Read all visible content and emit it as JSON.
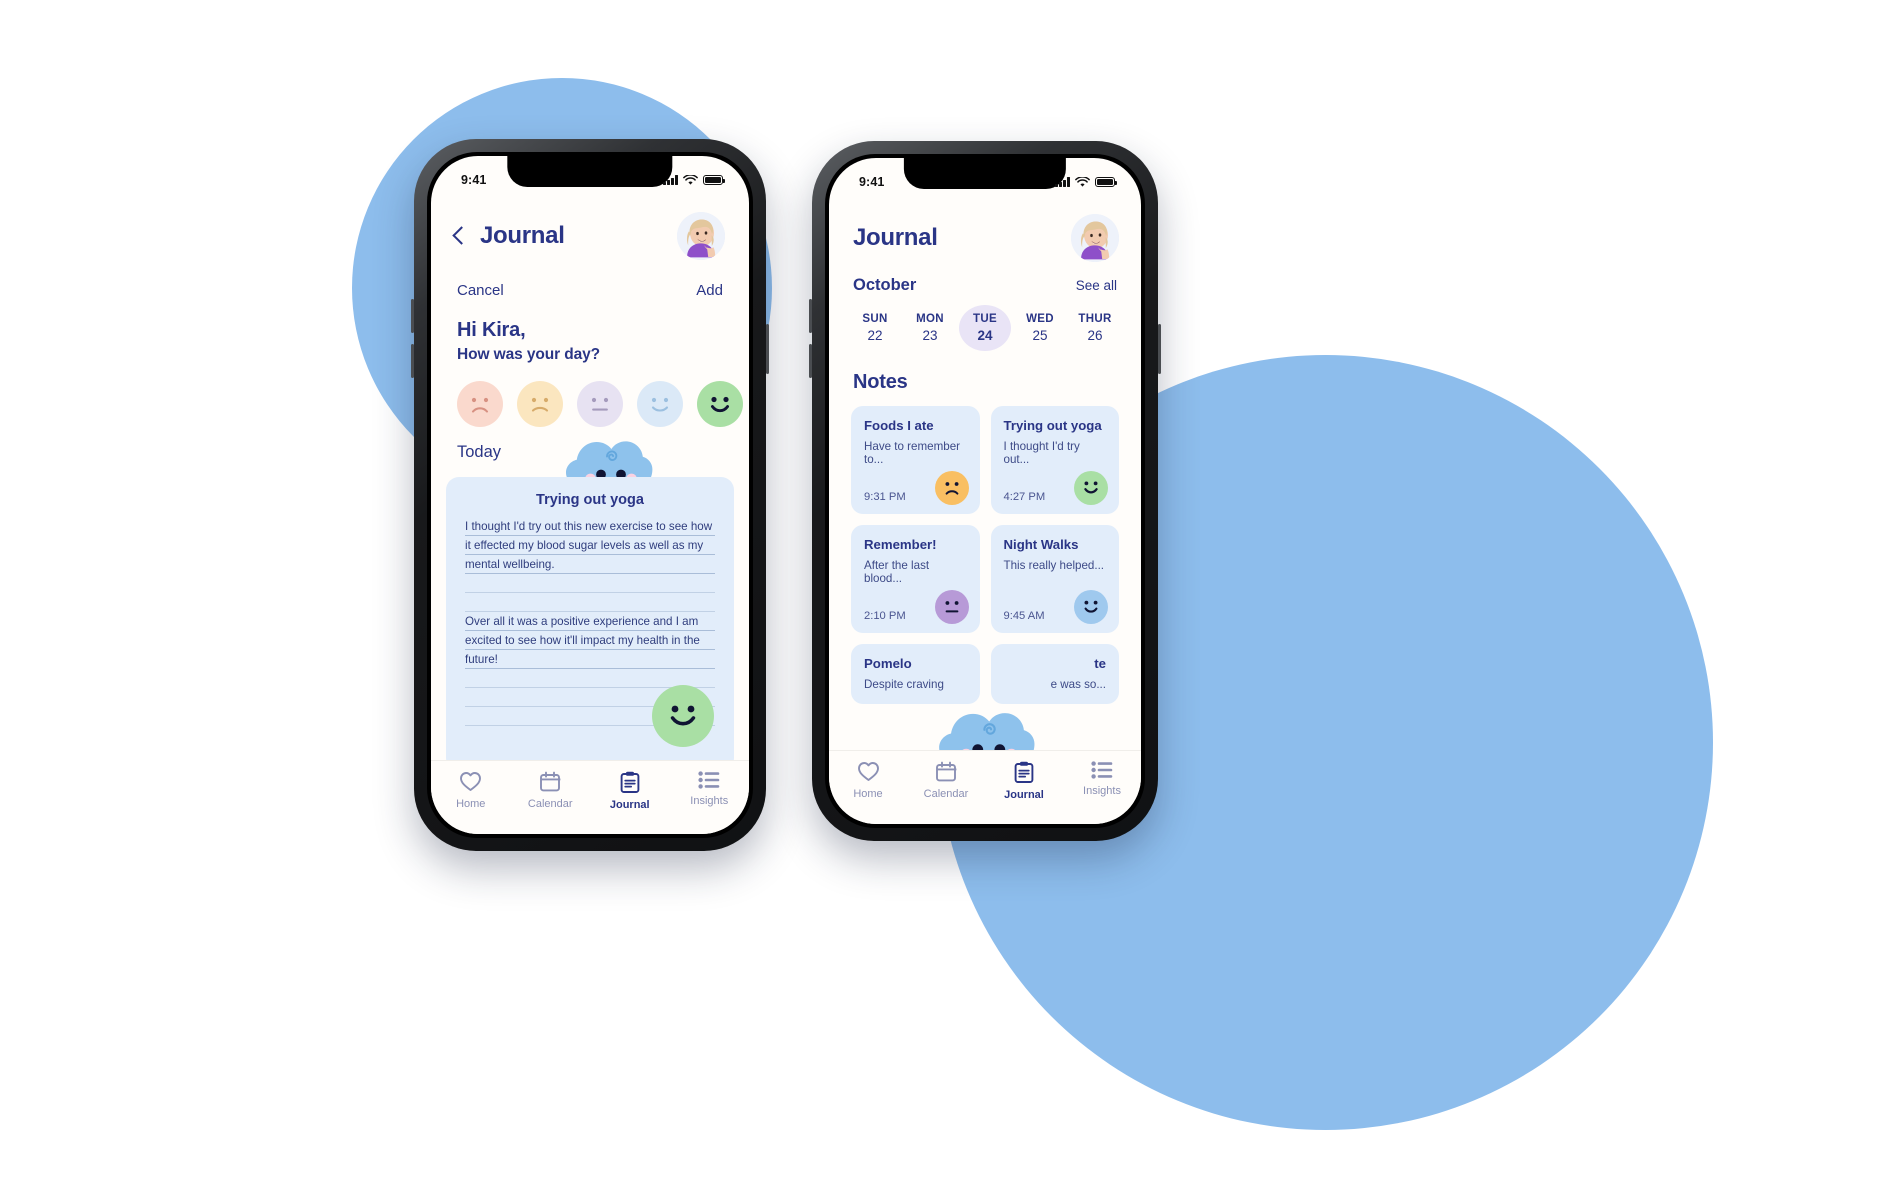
{
  "colors": {
    "brand_navy": "#2a3586",
    "blob_blue": "#8dbdec",
    "card_blue": "#e2edfa",
    "selected_day": "#e9e4f6",
    "mood_sad": "#fad9cd",
    "mood_frown": "#fbe6bf",
    "mood_neutral": "#e7e2f2",
    "mood_slight": "#dbe9f7",
    "mood_happy": "#a9dfa4",
    "face_orange": "#f9bf62",
    "face_purple": "#b79ad7",
    "face_blue": "#9fc9ee",
    "face_green": "#a9dfa4"
  },
  "phone_a": {
    "status": {
      "time": "9:41",
      "signal_icon": "cellular-bars-icon",
      "wifi_icon": "wifi-icon",
      "battery_icon": "battery-full-icon"
    },
    "header": {
      "back_icon": "chevron-left-icon",
      "title": "Journal",
      "avatar_icon": "user-avatar"
    },
    "actions": {
      "cancel": "Cancel",
      "add": "Add"
    },
    "greeting": {
      "hi": "Hi Kira,",
      "question": "How was your day?"
    },
    "moods": [
      {
        "name": "mood-very-sad",
        "color": "#fad9cd",
        "expression": "frown"
      },
      {
        "name": "mood-sad",
        "color": "#fbe6bf",
        "expression": "frown"
      },
      {
        "name": "mood-neutral",
        "color": "#e7e2f2",
        "expression": "flat"
      },
      {
        "name": "mood-good",
        "color": "#dbe9f7",
        "expression": "smile"
      },
      {
        "name": "mood-great",
        "color": "#a9dfa4",
        "expression": "smile-bold",
        "selected": true
      }
    ],
    "today_label": "Today",
    "mascot_icon": "cloud-mascot",
    "entry": {
      "title": "Trying out yoga",
      "lines": [
        "I thought I'd try out this new exercise to see how",
        "it effected my blood sugar levels as well as my",
        "mental wellbeing.",
        "",
        "",
        "Over all it was a positive experience and I am",
        "excited to see how it'll impact my health in the",
        "future!",
        "",
        "",
        ""
      ],
      "mood_face": "smile-bold",
      "mood_color": "#a9dfa4"
    },
    "tabs": [
      {
        "label": "Home",
        "icon": "heart-icon",
        "active": false
      },
      {
        "label": "Calendar",
        "icon": "calendar-icon",
        "active": false
      },
      {
        "label": "Journal",
        "icon": "clipboard-icon",
        "active": true
      },
      {
        "label": "Insights",
        "icon": "list-icon",
        "active": false
      }
    ]
  },
  "phone_b": {
    "status": {
      "time": "9:41",
      "signal_icon": "cellular-bars-icon",
      "wifi_icon": "wifi-icon",
      "battery_icon": "battery-full-icon"
    },
    "header": {
      "title": "Journal",
      "avatar_icon": "user-avatar"
    },
    "subheader": {
      "month": "October",
      "see_all": "See all"
    },
    "week": [
      {
        "dow": "SUN",
        "num": "22",
        "selected": false
      },
      {
        "dow": "MON",
        "num": "23",
        "selected": false
      },
      {
        "dow": "TUE",
        "num": "24",
        "selected": true
      },
      {
        "dow": "WED",
        "num": "25",
        "selected": false
      },
      {
        "dow": "THUR",
        "num": "26",
        "selected": false
      }
    ],
    "notes_heading": "Notes",
    "notes": [
      {
        "title": "Foods I ate",
        "preview": "Have to remember to...",
        "time": "9:31 PM",
        "face": "frown",
        "color": "#f9bf62"
      },
      {
        "title": "Trying out yoga",
        "preview": "I thought I'd try out...",
        "time": "4:27 PM",
        "face": "smile-bold",
        "color": "#a9dfa4"
      },
      {
        "title": "Remember!",
        "preview": "After the last blood...",
        "time": "2:10 PM",
        "face": "flat",
        "color": "#b79ad7"
      },
      {
        "title": "Night Walks",
        "preview": "This really helped...",
        "time": "9:45 AM",
        "face": "smile",
        "color": "#9fc9ee"
      }
    ],
    "notes_partial": [
      {
        "title": "Pomelo",
        "preview": "Despite craving"
      },
      {
        "title": "te",
        "preview": "e was so..."
      }
    ],
    "mascot_icon": "cloud-mascot",
    "tabs": [
      {
        "label": "Home",
        "icon": "heart-icon",
        "active": false
      },
      {
        "label": "Calendar",
        "icon": "calendar-icon",
        "active": false
      },
      {
        "label": "Journal",
        "icon": "clipboard-icon",
        "active": true
      },
      {
        "label": "Insights",
        "icon": "list-icon",
        "active": false
      }
    ]
  }
}
